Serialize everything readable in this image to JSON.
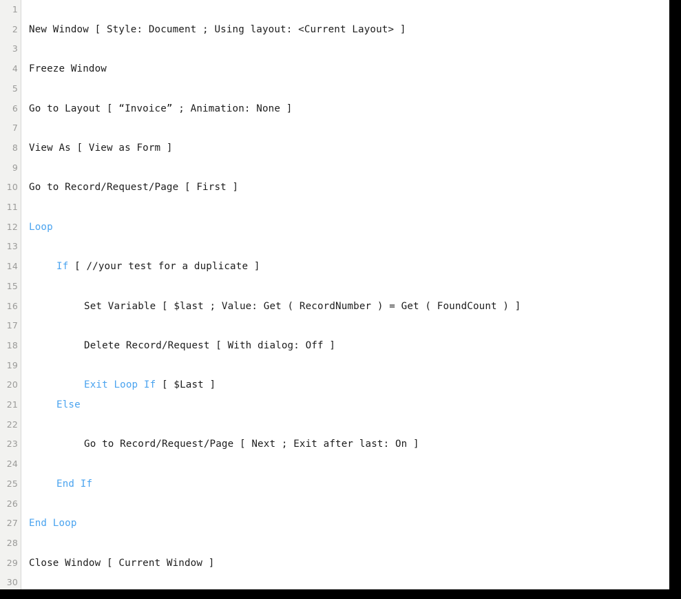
{
  "editor": {
    "name": "filemaker-script-editor",
    "total_lines": 30,
    "keyword_color": "#4aa3ef",
    "text_color": "#1c1c1c",
    "gutter_background": "#f2f2f0",
    "gutter_text_color": "#9a9a98",
    "code_background": "#ffffff",
    "frame_border_color": "#000000"
  },
  "lines": [
    {
      "number": "1",
      "indent": 0,
      "segments": []
    },
    {
      "number": "2",
      "indent": 0,
      "segments": [
        {
          "text": "New Window [ Style: Document ; Using layout: <Current Layout> ]",
          "kind": "plain"
        }
      ]
    },
    {
      "number": "3",
      "indent": 0,
      "segments": []
    },
    {
      "number": "4",
      "indent": 0,
      "segments": [
        {
          "text": "Freeze Window",
          "kind": "plain"
        }
      ]
    },
    {
      "number": "5",
      "indent": 0,
      "segments": []
    },
    {
      "number": "6",
      "indent": 0,
      "segments": [
        {
          "text": "Go to Layout [ “Invoice” ; Animation: None ]",
          "kind": "plain"
        }
      ]
    },
    {
      "number": "7",
      "indent": 0,
      "segments": []
    },
    {
      "number": "8",
      "indent": 0,
      "segments": [
        {
          "text": "View As [ View as Form ]",
          "kind": "plain"
        }
      ]
    },
    {
      "number": "9",
      "indent": 0,
      "segments": []
    },
    {
      "number": "10",
      "indent": 0,
      "segments": [
        {
          "text": "Go to Record/Request/Page [ First ]",
          "kind": "plain"
        }
      ]
    },
    {
      "number": "11",
      "indent": 0,
      "segments": []
    },
    {
      "number": "12",
      "indent": 0,
      "segments": [
        {
          "text": "Loop",
          "kind": "keyword"
        }
      ]
    },
    {
      "number": "13",
      "indent": 0,
      "segments": []
    },
    {
      "number": "14",
      "indent": 1,
      "segments": [
        {
          "text": "If ",
          "kind": "keyword"
        },
        {
          "text": "[ //your test for a duplicate ]",
          "kind": "plain"
        }
      ]
    },
    {
      "number": "15",
      "indent": 0,
      "segments": []
    },
    {
      "number": "16",
      "indent": 2,
      "segments": [
        {
          "text": "Set Variable [ $last ; Value: Get ( RecordNumber ) = Get ( FoundCount ) ]",
          "kind": "plain"
        }
      ]
    },
    {
      "number": "17",
      "indent": 0,
      "segments": []
    },
    {
      "number": "18",
      "indent": 2,
      "segments": [
        {
          "text": "Delete Record/Request [ With dialog: Off ]",
          "kind": "plain"
        }
      ]
    },
    {
      "number": "19",
      "indent": 0,
      "segments": []
    },
    {
      "number": "20",
      "indent": 2,
      "segments": [
        {
          "text": "Exit Loop If ",
          "kind": "keyword"
        },
        {
          "text": "[ $Last ]",
          "kind": "plain"
        }
      ]
    },
    {
      "number": "21",
      "indent": 1,
      "segments": [
        {
          "text": "Else",
          "kind": "keyword"
        }
      ]
    },
    {
      "number": "22",
      "indent": 0,
      "segments": []
    },
    {
      "number": "23",
      "indent": 2,
      "segments": [
        {
          "text": "Go to Record/Request/Page [ Next ; Exit after last: On ]",
          "kind": "plain"
        }
      ]
    },
    {
      "number": "24",
      "indent": 0,
      "segments": []
    },
    {
      "number": "25",
      "indent": 1,
      "segments": [
        {
          "text": "End If",
          "kind": "keyword"
        }
      ]
    },
    {
      "number": "26",
      "indent": 0,
      "segments": []
    },
    {
      "number": "27",
      "indent": 0,
      "segments": [
        {
          "text": "End Loop",
          "kind": "keyword"
        }
      ]
    },
    {
      "number": "28",
      "indent": 0,
      "segments": []
    },
    {
      "number": "29",
      "indent": 0,
      "segments": [
        {
          "text": "Close Window [ Current Window ]",
          "kind": "plain"
        }
      ]
    },
    {
      "number": "30",
      "indent": 0,
      "segments": []
    }
  ]
}
